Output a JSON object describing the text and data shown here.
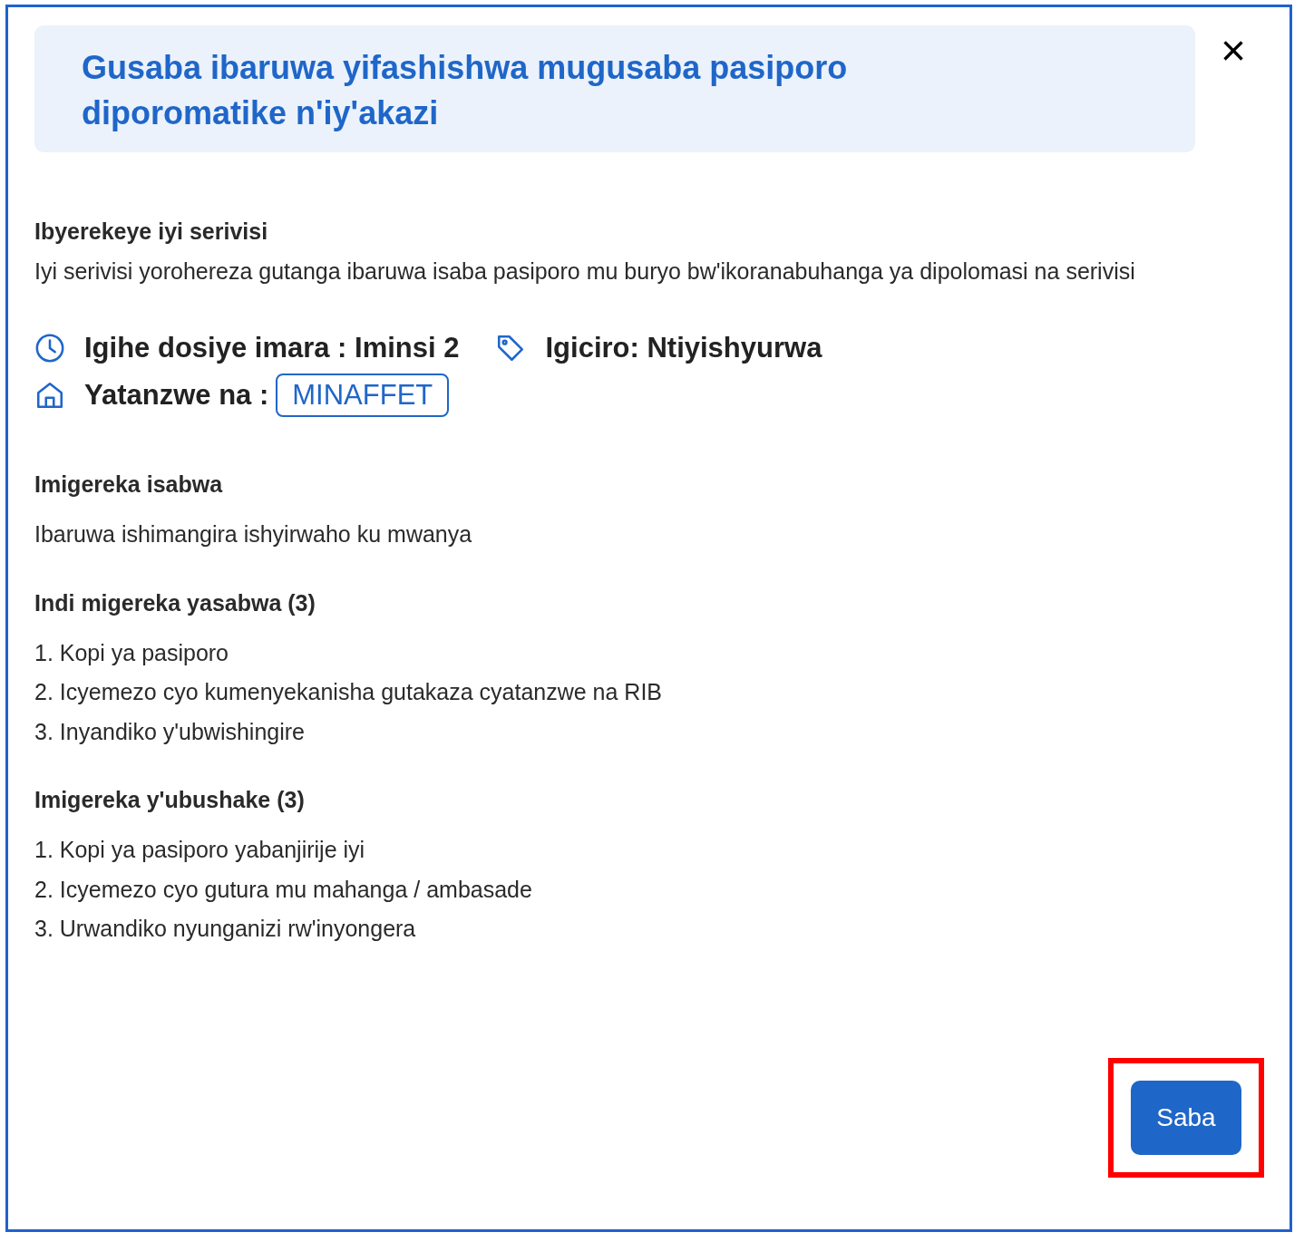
{
  "dialog": {
    "title": "Gusaba ibaruwa yifashishwa mugusaba pasiporo diporomatike n'iy'akazi",
    "close": "×"
  },
  "about": {
    "heading": "Ibyerekeye iyi serivisi",
    "text": "Iyi serivisi yorohereza gutanga ibaruwa isaba pasiporo mu buryo bw'ikoranabuhanga ya dipolomasi na serivisi"
  },
  "info": [
    {
      "kind": "clock",
      "label": "Igihe dosiye imara : Iminsi 2"
    },
    {
      "kind": "tag",
      "label": "Igiciro: Ntiyishyurwa"
    },
    {
      "kind": "home",
      "label": "Yatanzwe na :",
      "badge": "MINAFFET"
    }
  ],
  "sections": [
    {
      "heading": "Imigereka isabwa",
      "items": [
        "Ibaruwa ishimangira ishyirwaho ku mwanya"
      ]
    },
    {
      "heading": "Indi migereka yasabwa (3)",
      "items": [
        "1. Kopi ya pasiporo",
        "2. Icyemezo cyo kumenyekanisha gutakaza cyatanzwe na RIB",
        "3. Inyandiko y'ubwishingire"
      ]
    },
    {
      "heading": "Imigereka y'ubushake (3)",
      "items": [
        "1. Kopi ya pasiporo yabanjirije iyi",
        "2. Icyemezo cyo gutura mu mahanga / ambasade",
        "3. Urwandiko nyunganizi rw'inyongera"
      ]
    }
  ],
  "button": {
    "label": "Saba",
    "highlighted": true
  }
}
